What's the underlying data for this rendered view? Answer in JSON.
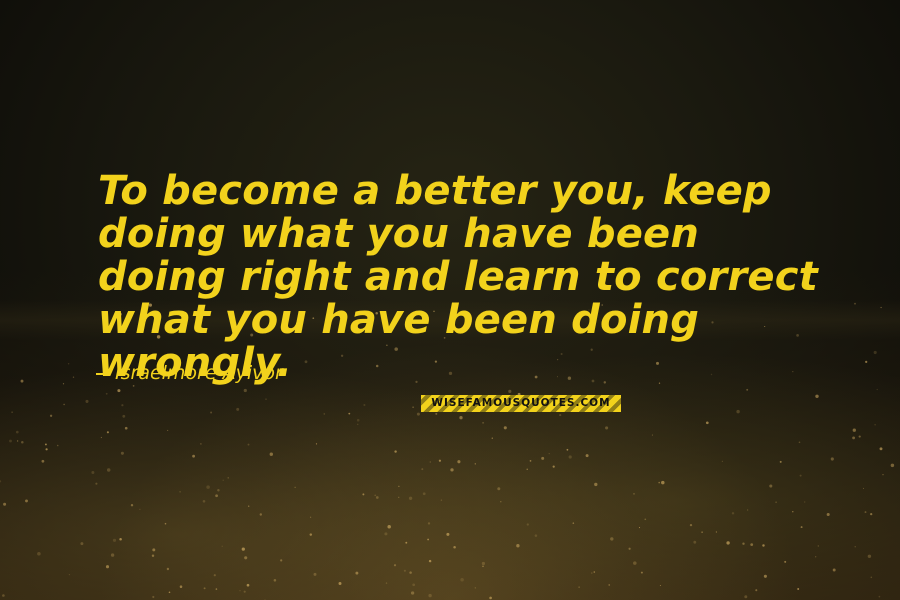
{
  "quote": {
    "text": "To become a better you, keep doing what you have been doing right and learn to correct what you have been doing wrongly.",
    "author": "Israelmore Ayivor"
  },
  "watermark": {
    "text": "WISEFAMOUSQUOTES.COM"
  },
  "colors": {
    "quote_text": "#f2d21c",
    "background": "#1a190f"
  }
}
